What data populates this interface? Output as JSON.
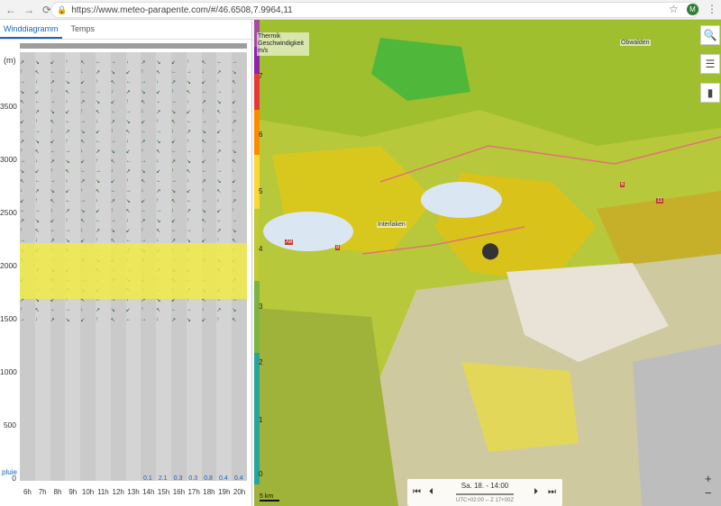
{
  "browser": {
    "url": "https://www.meteo-parapente.com/#/46.6508,7.9964,11",
    "avatar": "M"
  },
  "left": {
    "tabs": [
      "Winddiagramm",
      "Temps"
    ],
    "unit": "(m)",
    "rain_label": "pluie",
    "yticks": [
      "3500",
      "3000",
      "2500",
      "2000",
      "1500",
      "1000",
      "500",
      "0"
    ],
    "hours": [
      "6h",
      "7h",
      "8h",
      "9h",
      "10h",
      "11h",
      "12h",
      "13h",
      "14h",
      "15h",
      "16h",
      "17h",
      "18h",
      "19h",
      "20h"
    ],
    "rain": [
      "",
      "",
      "",
      "",
      "",
      "",
      "",
      "",
      "0.1",
      "2.1",
      "0.3",
      "0.3",
      "0.8",
      "0.4",
      "0.4"
    ]
  },
  "map": {
    "legend_title": "Thermik Geschwindigkeit m/s",
    "legend_values": [
      "7",
      "6",
      "5",
      "4",
      "3",
      "2",
      "1",
      "0"
    ],
    "places": [
      "Obwalden",
      "Interlaken"
    ],
    "roads": [
      "A8",
      "8",
      "6",
      "11"
    ],
    "playbar": {
      "time": "Sa. 18. - 14:00",
      "utc": "UTC+02:00 -- Z 17+00Z"
    },
    "scale": "5 km",
    "zoom_in": "+",
    "zoom_out": "−"
  }
}
